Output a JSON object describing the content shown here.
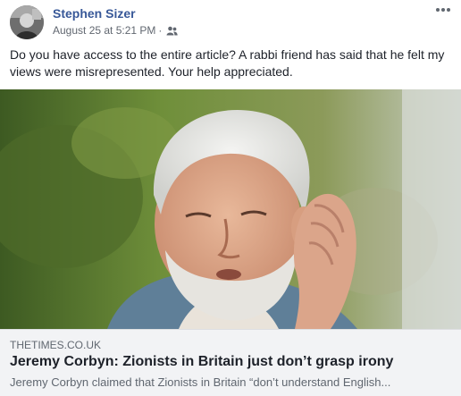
{
  "post": {
    "author": "Stephen Sizer",
    "timestamp": "August 25 at 5:21 PM",
    "separator": "·",
    "audience_icon": "friends-icon",
    "more_icon": "more-options-icon",
    "text": "Do you have access to the entire article? A rabbi friend has said that he felt my views were misrepresented. Your help appreciated."
  },
  "link": {
    "domain": "THETIMES.CO.UK",
    "title": "Jeremy Corbyn: Zionists in Britain just don’t grasp irony",
    "description": "Jeremy Corbyn claimed that Zionists in Britain “don’t understand English...",
    "image_subject": "man-cupping-ear-photo"
  },
  "colors": {
    "author_link": "#385898",
    "meta_text": "#616770",
    "body_text": "#1d2129",
    "card_background": "#f2f3f5"
  }
}
